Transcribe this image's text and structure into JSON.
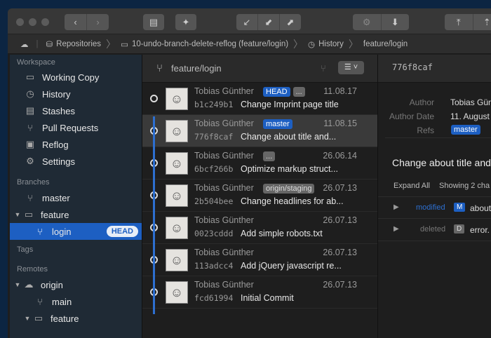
{
  "breadcrumb": {
    "items": [
      "Repositories",
      "10-undo-branch-delete-reflog (feature/login)",
      "History",
      "feature/login"
    ]
  },
  "sidebar": {
    "workspace_label": "Workspace",
    "workspace": [
      {
        "label": "Working Copy",
        "icon": "folder-icon"
      },
      {
        "label": "History",
        "icon": "clock-icon"
      },
      {
        "label": "Stashes",
        "icon": "clipboard-icon"
      },
      {
        "label": "Pull Requests",
        "icon": "pull-request-icon"
      },
      {
        "label": "Reflog",
        "icon": "reflog-icon"
      },
      {
        "label": "Settings",
        "icon": "gear-icon"
      }
    ],
    "branches_label": "Branches",
    "branches": {
      "master": "master",
      "folder": "feature",
      "login": "login",
      "head_badge": "HEAD"
    },
    "tags_label": "Tags",
    "remotes_label": "Remotes",
    "remotes": {
      "origin": "origin",
      "main": "main",
      "folder": "feature"
    }
  },
  "history": {
    "branch": "feature/login",
    "commits": [
      {
        "author": "Tobias Günther",
        "date": "11.08.17",
        "hash": "b1c249b1",
        "message": "Change Imprint page title",
        "refs": [
          "HEAD",
          "..."
        ]
      },
      {
        "author": "Tobias Günther",
        "date": "11.08.15",
        "hash": "776f8caf",
        "message": "Change about title and...",
        "refs": [
          "master"
        ]
      },
      {
        "author": "Tobias Günther",
        "date": "26.06.14",
        "hash": "6bcf266b",
        "message": "Optimize markup struct...",
        "refs": [
          "..."
        ]
      },
      {
        "author": "Tobias Günther",
        "date": "26.07.13",
        "hash": "2b504bee",
        "message": "Change headlines for ab...",
        "refs": [
          "origin/staging"
        ]
      },
      {
        "author": "Tobias Günther",
        "date": "26.07.13",
        "hash": "0023cddd",
        "message": "Add simple robots.txt",
        "refs": []
      },
      {
        "author": "Tobias Günther",
        "date": "26.07.13",
        "hash": "113adcc4",
        "message": "Add jQuery javascript re...",
        "refs": []
      },
      {
        "author": "Tobias Günther",
        "date": "26.07.13",
        "hash": "fcd61994",
        "message": "Initial Commit",
        "refs": []
      }
    ]
  },
  "details": {
    "hash": "776f8caf",
    "author_label": "Author",
    "author": "Tobias Günt",
    "date_label": "Author Date",
    "date": "11. August 2",
    "refs_label": "Refs",
    "ref": "master",
    "subject": "Change about title and",
    "expand_all": "Expand All",
    "showing": "Showing 2 cha",
    "files": [
      {
        "status": "modified",
        "badge": "M",
        "name": "about"
      },
      {
        "status": "deleted",
        "badge": "D",
        "name": "error."
      }
    ]
  },
  "colors": {
    "accent": "#1d5fc2",
    "background": "#0c2542"
  }
}
